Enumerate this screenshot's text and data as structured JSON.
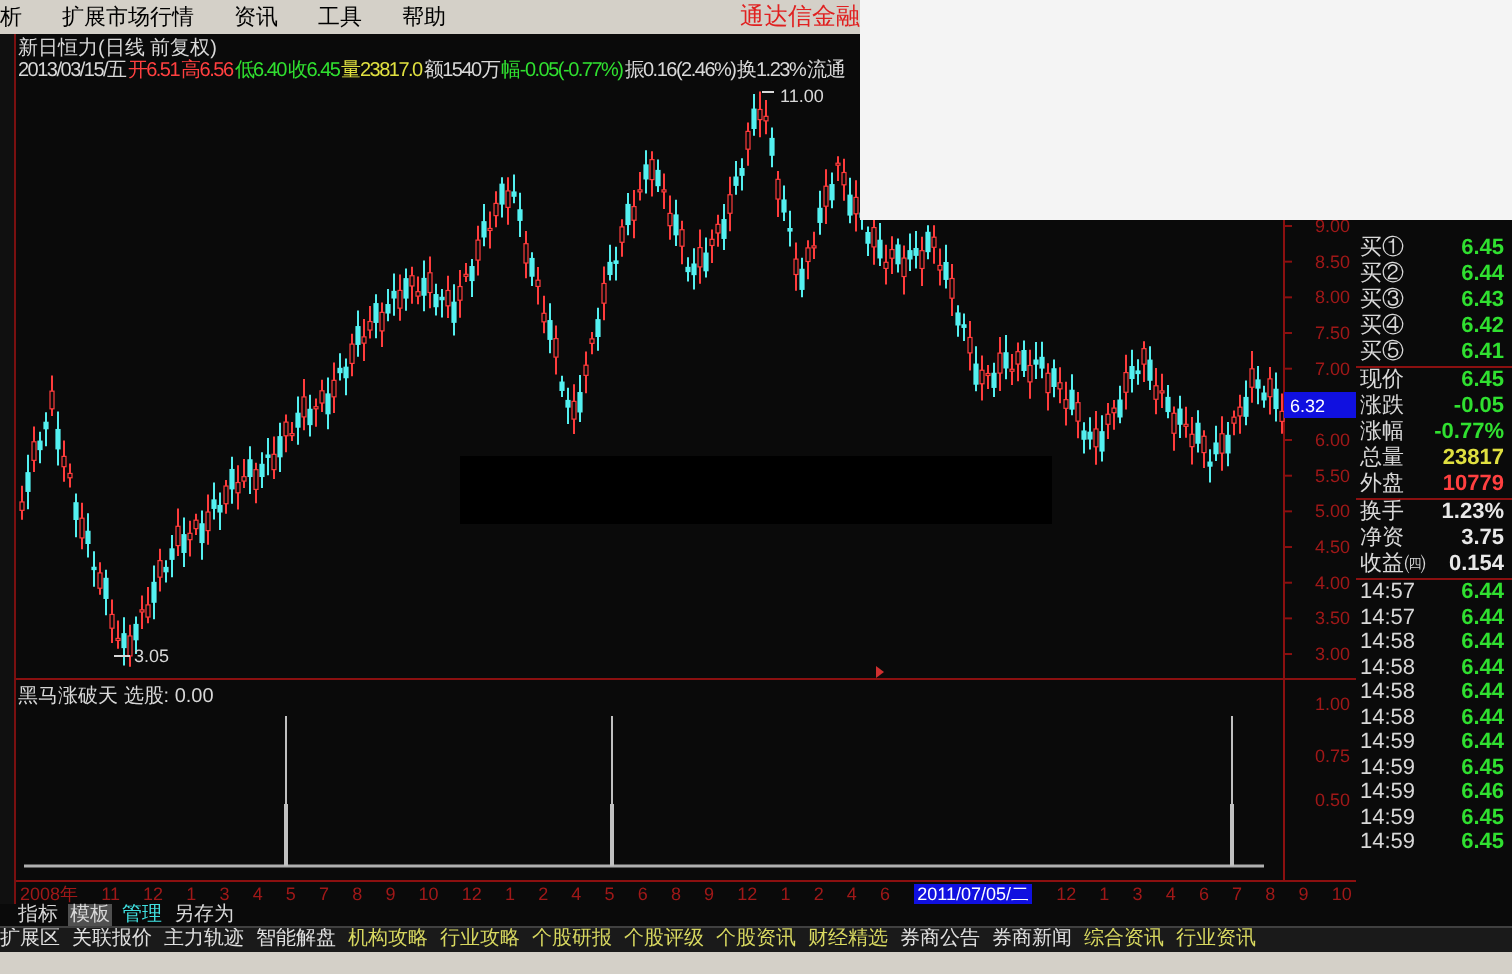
{
  "menu": {
    "items": [
      "析",
      "扩展市场行情",
      "资讯",
      "工具",
      "帮助"
    ],
    "brand": "通达信金融"
  },
  "chart": {
    "title": "新日恒力(日线 前复权)",
    "info": [
      {
        "text": "2013/03/15/五",
        "kind": "plain"
      },
      {
        "text": "开6.51",
        "kind": "up"
      },
      {
        "text": "高6.56",
        "kind": "up"
      },
      {
        "text": "低6.40",
        "kind": "down"
      },
      {
        "text": "收6.45",
        "kind": "down"
      },
      {
        "text": "量23817.0",
        "kind": "volume"
      },
      {
        "text": "额1540万",
        "kind": "plain"
      },
      {
        "text": "幅-0.05(-0.77%)",
        "kind": "down"
      },
      {
        "text": "振0.16(2.46%)",
        "kind": "plain"
      },
      {
        "text": "换1.23%",
        "kind": "plain"
      },
      {
        "text": "流通",
        "kind": "plain"
      }
    ],
    "high_label": "11.00",
    "low_label": "3.05",
    "axis_ticks": [
      "9.00",
      "8.50",
      "8.00",
      "7.50",
      "7.00",
      "6.00",
      "5.50",
      "5.00",
      "4.50",
      "4.00",
      "3.50",
      "3.00"
    ],
    "cursor_tag": "6.32"
  },
  "indicator": {
    "title": "黑马涨破天 选股: 0.00",
    "axis_ticks": [
      "1.00",
      "0.75",
      "0.50"
    ]
  },
  "dates": [
    {
      "text": "2008年",
      "selected": false
    },
    {
      "text": "11",
      "selected": false
    },
    {
      "text": "12",
      "selected": false
    },
    {
      "text": "1",
      "selected": false
    },
    {
      "text": "3",
      "selected": false
    },
    {
      "text": "4",
      "selected": false
    },
    {
      "text": "5",
      "selected": false
    },
    {
      "text": "7",
      "selected": false
    },
    {
      "text": "8",
      "selected": false
    },
    {
      "text": "9",
      "selected": false
    },
    {
      "text": "10",
      "selected": false
    },
    {
      "text": "12",
      "selected": false
    },
    {
      "text": "1",
      "selected": false
    },
    {
      "text": "2",
      "selected": false
    },
    {
      "text": "4",
      "selected": false
    },
    {
      "text": "5",
      "selected": false
    },
    {
      "text": "6",
      "selected": false
    },
    {
      "text": "8",
      "selected": false
    },
    {
      "text": "9",
      "selected": false
    },
    {
      "text": "12",
      "selected": false
    },
    {
      "text": "1",
      "selected": false
    },
    {
      "text": "2",
      "selected": false
    },
    {
      "text": "4",
      "selected": false
    },
    {
      "text": "6",
      "selected": false
    },
    {
      "text": "2011/07/05/二",
      "selected": true
    },
    {
      "text": "12",
      "selected": false
    },
    {
      "text": "1",
      "selected": false
    },
    {
      "text": "3",
      "selected": false
    },
    {
      "text": "4",
      "selected": false
    },
    {
      "text": "6",
      "selected": false
    },
    {
      "text": "7",
      "selected": false
    },
    {
      "text": "8",
      "selected": false
    },
    {
      "text": "9",
      "selected": false
    },
    {
      "text": "10",
      "selected": false
    }
  ],
  "tabs": [
    {
      "label": "指标",
      "selected": false,
      "kind": "plain"
    },
    {
      "label": "模板",
      "selected": true,
      "kind": "plain"
    },
    {
      "label": "管理",
      "selected": false,
      "kind": "accent"
    },
    {
      "label": "另存为",
      "selected": false,
      "kind": "plain"
    }
  ],
  "quote": {
    "bids": [
      {
        "label": "买①",
        "value": "6.45"
      },
      {
        "label": "买②",
        "value": "6.44"
      },
      {
        "label": "买③",
        "value": "6.43"
      },
      {
        "label": "买④",
        "value": "6.42"
      },
      {
        "label": "买⑤",
        "value": "6.41"
      }
    ],
    "stats": [
      {
        "label": "现价",
        "value": "6.45",
        "kind": "down"
      },
      {
        "label": "涨跌",
        "value": "-0.05",
        "kind": "down"
      },
      {
        "label": "涨幅",
        "value": "-0.77%",
        "kind": "down"
      },
      {
        "label": "总量",
        "value": "23817",
        "kind": "volume"
      },
      {
        "label": "外盘",
        "value": "10779",
        "kind": "up"
      }
    ],
    "fundamentals": [
      {
        "label": "换手",
        "value": "1.23%"
      },
      {
        "label": "净资",
        "value": "3.75"
      },
      {
        "label": "收益㈣",
        "value": "0.154"
      }
    ],
    "ticks": [
      {
        "time": "14:57",
        "price": "6.44"
      },
      {
        "time": "14:57",
        "price": "6.44"
      },
      {
        "time": "14:58",
        "price": "6.44"
      },
      {
        "time": "14:58",
        "price": "6.44"
      },
      {
        "time": "14:58",
        "price": "6.44"
      },
      {
        "time": "14:58",
        "price": "6.44"
      },
      {
        "time": "14:59",
        "price": "6.44"
      },
      {
        "time": "14:59",
        "price": "6.45"
      },
      {
        "time": "14:59",
        "price": "6.46"
      },
      {
        "time": "14:59",
        "price": "6.45"
      },
      {
        "time": "14:59",
        "price": "6.45"
      }
    ]
  },
  "bottom_bar": [
    {
      "label": "扩展区",
      "kind": "plain"
    },
    {
      "label": "关联报价",
      "kind": "plain"
    },
    {
      "label": "主力轨迹",
      "kind": "plain"
    },
    {
      "label": "智能解盘",
      "kind": "plain"
    },
    {
      "label": "机构攻略",
      "kind": "info"
    },
    {
      "label": "行业攻略",
      "kind": "info"
    },
    {
      "label": "个股研报",
      "kind": "info"
    },
    {
      "label": "个股评级",
      "kind": "info"
    },
    {
      "label": "个股资讯",
      "kind": "info"
    },
    {
      "label": "财经精选",
      "kind": "info"
    },
    {
      "label": "券商公告",
      "kind": "plain"
    },
    {
      "label": "券商新闻",
      "kind": "plain"
    },
    {
      "label": "综合资讯",
      "kind": "info"
    },
    {
      "label": "行业资讯",
      "kind": "info"
    }
  ]
}
